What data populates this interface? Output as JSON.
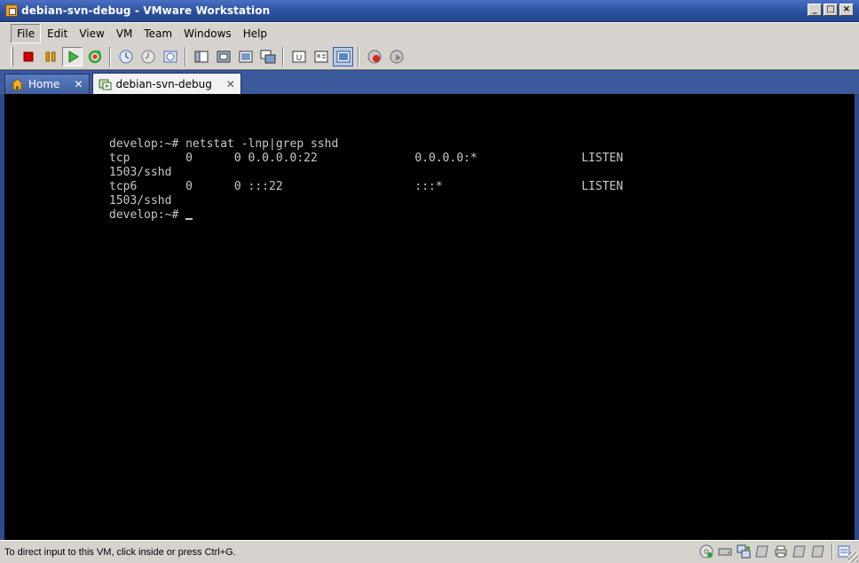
{
  "window": {
    "title": "debian-svn-debug - VMware Workstation",
    "controls": {
      "minimize": "_",
      "maximize": "□",
      "close": "×"
    }
  },
  "menu": {
    "items": [
      {
        "label": "File"
      },
      {
        "label": "Edit"
      },
      {
        "label": "View"
      },
      {
        "label": "VM"
      },
      {
        "label": "Team"
      },
      {
        "label": "Windows"
      },
      {
        "label": "Help"
      }
    ]
  },
  "toolbar": {
    "buttons": [
      {
        "icon": "power-off-icon",
        "color": "#cc0000"
      },
      {
        "icon": "suspend-icon",
        "color": "#e89a00"
      },
      {
        "icon": "power-on-icon",
        "color": "#2fa52f"
      },
      {
        "icon": "reset-icon",
        "color": "#2fa52f"
      },
      {
        "icon": "snapshot-icon"
      },
      {
        "icon": "revert-snapshot-icon"
      },
      {
        "icon": "snapshot-manager-icon"
      },
      {
        "icon": "sidebar-icon"
      },
      {
        "icon": "quick-switch-icon"
      },
      {
        "icon": "fit-window-icon"
      },
      {
        "icon": "full-screen-icon"
      },
      {
        "icon": "unity-icon"
      },
      {
        "icon": "console-view-icon"
      },
      {
        "icon": "summary-view-icon"
      },
      {
        "icon": "record-icon"
      },
      {
        "icon": "replay-icon"
      }
    ]
  },
  "tabs": [
    {
      "label": "Home",
      "icon": "home-icon",
      "active": false
    },
    {
      "label": "debian-svn-debug",
      "icon": "vm-icon",
      "active": true
    }
  ],
  "terminal": {
    "lines": [
      "develop:~# netstat -lnp|grep sshd",
      "tcp        0      0 0.0.0.0:22              0.0.0.0:*               LISTEN",
      "1503/sshd",
      "tcp6       0      0 :::22                   :::*                    LISTEN",
      "1503/sshd",
      "develop:~# "
    ]
  },
  "status": {
    "text": "To direct input to this VM, click inside or press Ctrl+G.",
    "icons": [
      "cdrom-icon",
      "hard-disk-icon",
      "network-adapter-icon",
      "floppy-icon",
      "printer-icon",
      "usb-icon",
      "sound-icon",
      "message-log-icon"
    ]
  }
}
